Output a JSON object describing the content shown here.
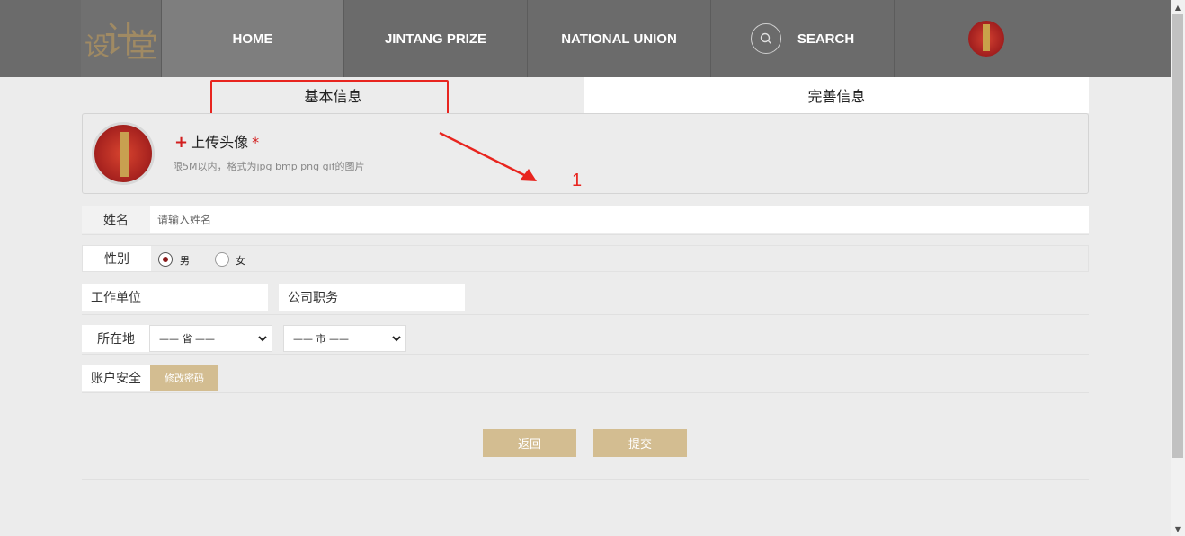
{
  "nav": {
    "logo_text": "设计堂",
    "home": "HOME",
    "prize": "JINTANG PRIZE",
    "union": "NATIONAL UNION",
    "search": "SEARCH"
  },
  "tabs": {
    "basic": "基本信息",
    "more": "完善信息"
  },
  "upload": {
    "plus": "+",
    "title": "上传头像",
    "required_mark": "*",
    "hint": "限5M以内，格式为jpg bmp png gif的图片"
  },
  "annotation": {
    "number": "1"
  },
  "form": {
    "name_label": "姓名",
    "name_placeholder": "请输入姓名",
    "gender_label": "性别",
    "gender_male": "男",
    "gender_female": "女",
    "gender_selected": "男",
    "org_label": "工作单位",
    "position_label": "公司职务",
    "location_label": "所在地",
    "province_select": "—— 省 ——",
    "city_select": "—— 市 ——",
    "account_label": "账户安全",
    "change_password": "修改密码"
  },
  "actions": {
    "back": "返回",
    "submit": "提交"
  },
  "colors": {
    "header_bg": "#6b6b6b",
    "accent_gold": "#d3bd91",
    "annotation_red": "#e8251f"
  }
}
